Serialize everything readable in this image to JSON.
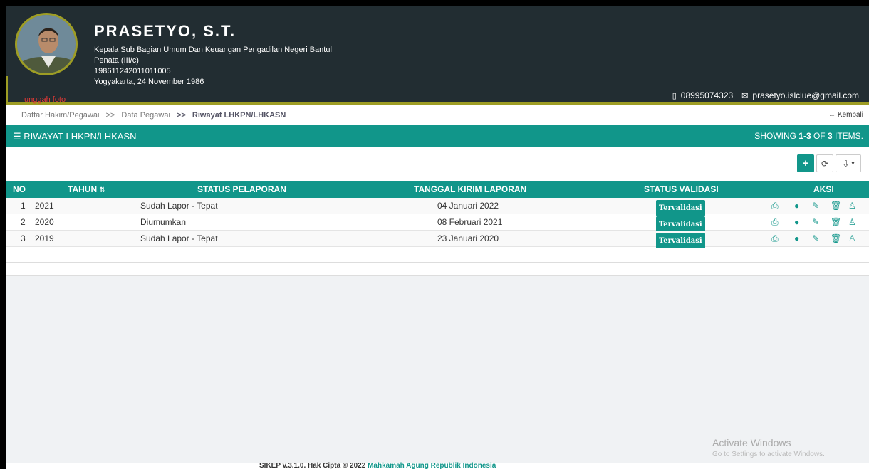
{
  "profile": {
    "name": "PRASETYO, S.T.",
    "position": "Kepala Sub Bagian Umum Dan Keuangan Pengadilan Negeri Bantul",
    "rank": "Penata (III/c)",
    "nip": "198611242011011005",
    "birth": "Yogyakarta, 24 November 1986",
    "upload_label": "unggah foto",
    "phone": "08995074323",
    "email": "prasetyo.islclue@gmail.com"
  },
  "breadcrumb": {
    "item1": "Daftar Hakim/Pegawai",
    "sep1": ">>",
    "item2": "Data Pegawai",
    "sep2": ">>",
    "current": "Riwayat LHKPN/LHKASN",
    "back_label": "Kembali"
  },
  "panel": {
    "title": "RIWAYAT LHKPN/LHKASN",
    "summary_prefix": "SHOWING ",
    "summary_range": "1-3",
    "summary_mid": " OF ",
    "summary_total": "3",
    "summary_suffix": " ITEMS."
  },
  "table": {
    "headers": {
      "no": "NO",
      "tahun": "TAHUN",
      "status_pelaporan": "STATUS PELAPORAN",
      "tanggal": "TANGGAL KIRIM LAPORAN",
      "status_validasi": "STATUS VALIDASI",
      "aksi": "AKSI"
    },
    "rows": [
      {
        "no": "1",
        "tahun": "2021",
        "status": "Sudah Lapor - Tepat",
        "tanggal": "04 Januari 2022",
        "validasi": "Tervalidasi"
      },
      {
        "no": "2",
        "tahun": "2020",
        "status": "Diumumkan",
        "tanggal": "08 Februari 2021",
        "validasi": "Tervalidasi"
      },
      {
        "no": "3",
        "tahun": "2019",
        "status": "Sudah Lapor - Tepat",
        "tanggal": "23 Januari 2020",
        "validasi": "Tervalidasi"
      }
    ]
  },
  "watermark": {
    "title": "Activate Windows",
    "subtitle": "Go to Settings to activate Windows."
  },
  "footer": {
    "prefix": "SIKEP v.3.1.0. Hak Cipta © 2022 ",
    "org": "Mahkamah Agung Republik Indonesia"
  },
  "colors": {
    "teal": "#11968a",
    "header_bg": "#222d32",
    "accent": "#9e9d24"
  }
}
